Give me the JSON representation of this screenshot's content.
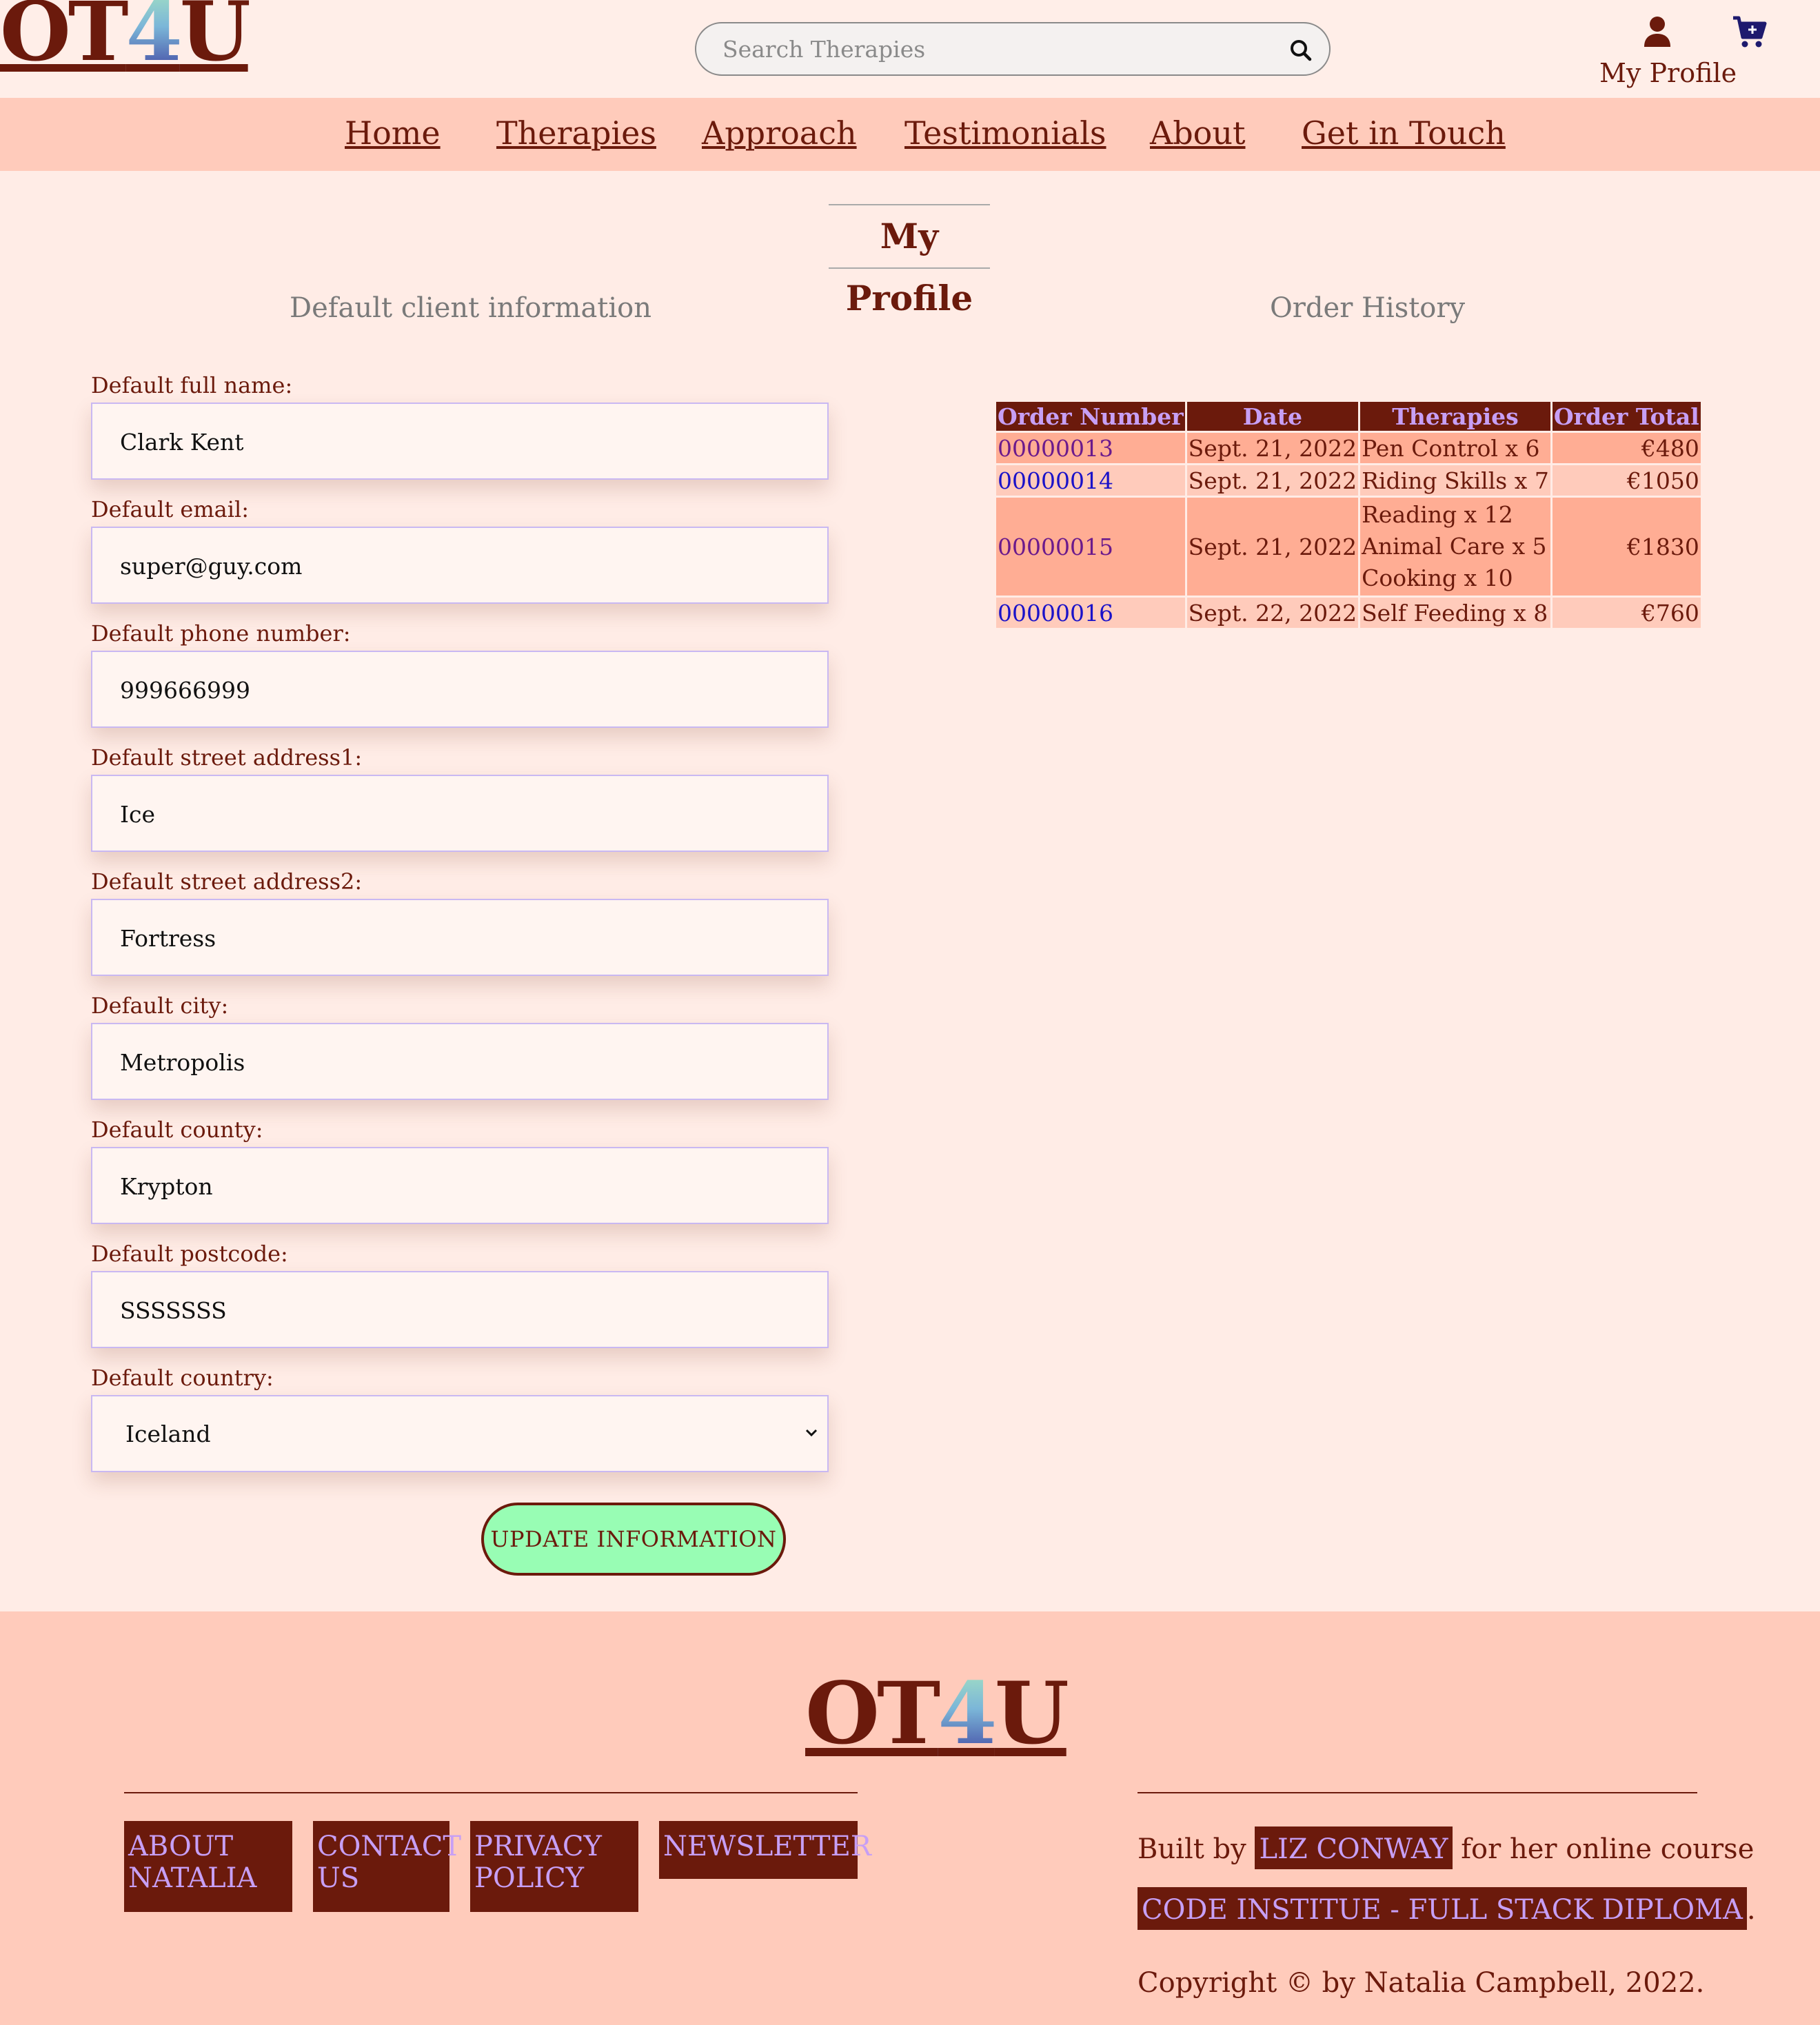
{
  "brand": {
    "logo_left": "OT",
    "logo_four": "4",
    "logo_right": "U"
  },
  "header": {
    "search": {
      "placeholder": "Search Therapies",
      "value": ""
    },
    "profile_label": "My Profile"
  },
  "nav": {
    "items": [
      "Home",
      "Therapies",
      "Approach",
      "Testimonials",
      "About",
      "Get in Touch"
    ]
  },
  "page": {
    "title": "My Profile"
  },
  "client_info": {
    "heading": "Default client information",
    "fields": [
      {
        "label": "Default full name:",
        "value": "Clark Kent"
      },
      {
        "label": "Default email:",
        "value": "super@guy.com"
      },
      {
        "label": "Default phone number:",
        "value": "999666999"
      },
      {
        "label": "Default street address1:",
        "value": "Ice"
      },
      {
        "label": "Default street address2:",
        "value": "Fortress"
      },
      {
        "label": "Default city:",
        "value": "Metropolis"
      },
      {
        "label": "Default county:",
        "value": "Krypton"
      },
      {
        "label": "Default postcode:",
        "value": "SSSSSSS"
      },
      {
        "label": "Default country:",
        "value": "Iceland"
      }
    ],
    "update_button": "UPDATE INFORMATION"
  },
  "order_history": {
    "heading": "Order History",
    "columns": [
      "Order Number",
      "Date",
      "Therapies",
      "Order Total"
    ],
    "rows": [
      {
        "number": "00000013",
        "date": "Sept. 21, 2022",
        "therapies": [
          "Pen Control x 6"
        ],
        "total": "€480"
      },
      {
        "number": "00000014",
        "date": "Sept. 21, 2022",
        "therapies": [
          "Riding Skills x 7"
        ],
        "total": "€1050"
      },
      {
        "number": "00000015",
        "date": "Sept. 21, 2022",
        "therapies": [
          "Reading x 12",
          "Animal Care x 5",
          "Cooking x 10"
        ],
        "total": "€1830"
      },
      {
        "number": "00000016",
        "date": "Sept. 22, 2022",
        "therapies": [
          "Self Feeding x 8"
        ],
        "total": "€760"
      }
    ]
  },
  "footer": {
    "links": [
      "ABOUT NATALIA",
      "CONTACT US",
      "PRIVACY POLICY",
      "NEWSLETTER"
    ],
    "built_by_prefix": "Built by",
    "author": "LIZ CONWAY",
    "built_by_suffix": "for her online course",
    "course": "CODE INSTITUE - FULL STACK DIPLOMA",
    "course_suffix": ".",
    "copyright": "Copyright © by Natalia Campbell, 2022."
  },
  "colors": {
    "brand_dark": "#6b1a0c",
    "nav_bg": "#ffcbbb",
    "page_bg": "#ffece6",
    "accent_lilac": "#c79ff5",
    "button_green": "#98fdb4",
    "icon_navy": "#1e1a6e"
  },
  "icons": [
    "search-icon",
    "user-icon",
    "cart-icon",
    "chevron-down-icon"
  ]
}
